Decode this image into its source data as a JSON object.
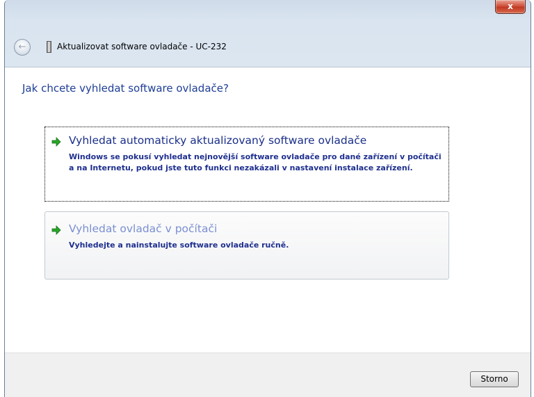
{
  "window": {
    "title": "Aktualizovat software ovladače - UC-232",
    "close_label": "x",
    "back_label": "←"
  },
  "main": {
    "heading": "Jak chcete vyhledat software ovladače?",
    "options": [
      {
        "title": "Vyhledat automaticky aktualizovaný software ovladače",
        "description": "Windows se pokusí vyhledat nejnovější software ovladače pro dané zařízení v počítači a na Internetu, pokud jste tuto funkci nezakázali v nastavení instalace zařízení."
      },
      {
        "title": "Vyhledat ovladač v počítači",
        "description": "Vyhledejte a nainstalujte software ovladače ručně."
      }
    ]
  },
  "footer": {
    "cancel_label": "Storno"
  },
  "colors": {
    "heading": "#1e3e96",
    "option_desc": "#1e2f8e",
    "arrow_green": "#2aa52a"
  },
  "icons": [
    "back-arrow-icon",
    "usb-device-icon",
    "green-arrow-icon",
    "close-icon"
  ]
}
